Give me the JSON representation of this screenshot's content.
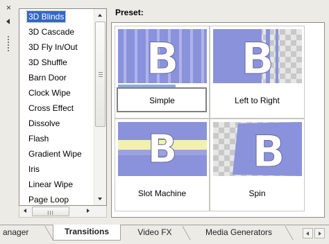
{
  "dock": {
    "close_glyph": "×"
  },
  "transition_list": {
    "selected_index": 0,
    "items": [
      "3D Blinds",
      "3D Cascade",
      "3D Fly In/Out",
      "3D Shuffle",
      "Barn Door",
      "Clock Wipe",
      "Cross Effect",
      "Dissolve",
      "Flash",
      "Gradient Wipe",
      "Iris",
      "Linear Wipe",
      "Page Loop"
    ],
    "hscroll_grip": "III"
  },
  "preset": {
    "label": "Preset:",
    "selected_index": 0,
    "items": [
      {
        "name": "Simple",
        "thumb_icon": "blinds-transition-thumbnail",
        "progress": 0.65
      },
      {
        "name": "Left to Right",
        "thumb_icon": "left-to-right-transition-thumbnail"
      },
      {
        "name": "Slot Machine",
        "thumb_icon": "slot-machine-transition-thumbnail"
      },
      {
        "name": "Spin",
        "thumb_icon": "spin-transition-thumbnail"
      }
    ]
  },
  "tabs": {
    "items": [
      "anager",
      "Transitions",
      "Video FX",
      "Media Generators"
    ],
    "active": "Transitions"
  },
  "colors": {
    "selection": "#3366cc",
    "thumb_blue": "#8a92dc",
    "progress": "#8fa9d9"
  }
}
